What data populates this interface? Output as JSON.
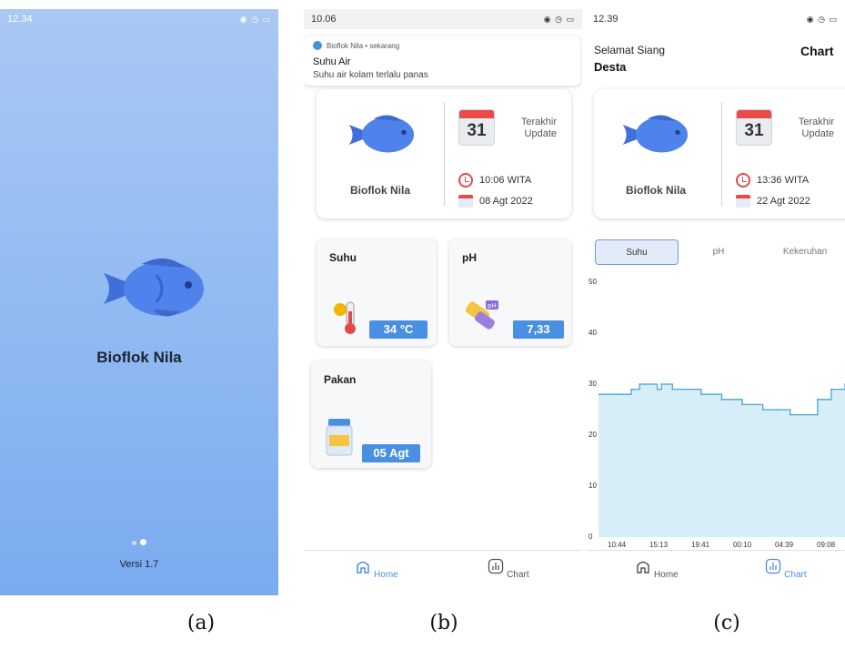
{
  "screen_a": {
    "status_time": "12.34",
    "app_name": "Bioflok Nila",
    "version": "Versi 1.7"
  },
  "screen_b": {
    "status_time": "10.06",
    "notification": {
      "source": "Bioflok Nila • sekarang",
      "title": "Suhu Air",
      "body": "Suhu air kolam terlalu panas"
    },
    "card": {
      "fish_name": "Bioflok Nila",
      "calendar_day": "31",
      "update_label": "Terakhir Update",
      "time": "10:06 WITA",
      "date": "08 Agt 2022"
    },
    "tiles": {
      "suhu_title": "Suhu",
      "suhu_value": "34 °C",
      "ph_title": "pH",
      "ph_value": "7,33",
      "pakan_title": "Pakan",
      "pakan_value": "05 Agt"
    },
    "nav": {
      "home": "Home",
      "chart": "Chart"
    }
  },
  "screen_c": {
    "status_time": "12.39",
    "greeting": "Selamat Siang",
    "user": "Desta",
    "header_title": "Chart",
    "card": {
      "fish_name": "Bioflok Nila",
      "calendar_day": "31",
      "update_label": "Terakhir Update",
      "time": "13:36 WITA",
      "date": "22 Agt 2022"
    },
    "tabs": {
      "suhu": "Suhu",
      "ph": "pH",
      "kekeruhan": "Kekeruhan"
    },
    "nav": {
      "home": "Home",
      "chart": "Chart"
    }
  },
  "captions": {
    "a": "(a)",
    "b": "(b)",
    "c": "(c)"
  },
  "colors": {
    "accent": "#4a90e2",
    "chart_fill": "#d6eef8",
    "chart_line": "#4aa3d8",
    "alert_red": "#e94b4b"
  },
  "chart_data": {
    "type": "area",
    "y_ticks": [
      "0",
      "10",
      "20",
      "30",
      "40",
      "50"
    ],
    "ylim": [
      0,
      50
    ],
    "x_tick_labels": [
      "10:44",
      "15:13",
      "19:41",
      "00:10",
      "04:39",
      "09:08"
    ],
    "x_positions": [
      0,
      1.5,
      2.4,
      2.6,
      3,
      3.4,
      3.8,
      4.3,
      4.6,
      5,
      5.4,
      6,
      7.5,
      9,
      10.5,
      12,
      13,
      14,
      15,
      16,
      17,
      18
    ],
    "values": [
      28,
      28,
      29,
      29,
      30,
      30,
      30,
      29,
      30,
      30,
      29,
      29,
      28,
      27,
      26,
      25,
      25,
      24,
      24,
      27,
      29,
      30
    ]
  }
}
